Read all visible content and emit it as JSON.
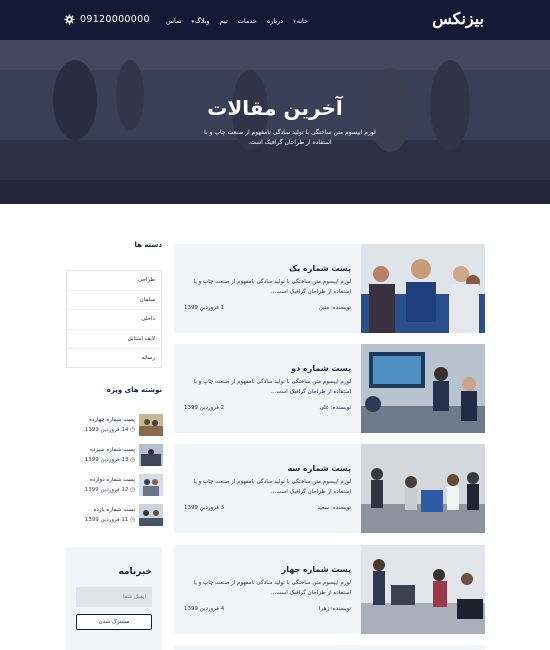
{
  "header": {
    "logo": "بیزنکس",
    "nav": [
      "خانه",
      "درباره",
      "خدمات",
      "تیم",
      "وبلاگ",
      "تماس"
    ],
    "phone": "09120000000"
  },
  "hero": {
    "title": "آخرین مقالات",
    "text": "لورم ایپسوم متن ساختگی با تولید سادگی نامفهوم از صنعت چاپ و با استفاده از طراحان گرافیک است."
  },
  "sidebar": {
    "categories_title": "دسته ها",
    "categories": [
      "طراحی",
      "مبلمان",
      "داخلی",
      "لایف استایل",
      "رسانه"
    ],
    "special_title": "نوشته های ویژه",
    "special": [
      {
        "title": "پست شماره چهارده",
        "date": "14 فروردین 1399"
      },
      {
        "title": "پست شماره سیزده",
        "date": "13 فروردین 1399"
      },
      {
        "title": "پست شماره دوازده",
        "date": "12 فروردین 1399"
      },
      {
        "title": "پست شماره یازده",
        "date": "11 فروردین 1399"
      }
    ],
    "newsletter": {
      "title": "خبرنامه",
      "placeholder": "ایمیل شما",
      "button": "مشترک شدن"
    }
  },
  "posts": [
    {
      "title": "پست شماره یک",
      "excerpt": "لورم ایپسوم متن ساختگی با تولید سادگی نامفهوم از صنعت چاپ و با استفاده از طراحان گرافیک است...",
      "author": "نویسنده: متین",
      "date": "1 فروردین 1399"
    },
    {
      "title": "پست شماره دو",
      "excerpt": "لورم ایپسوم متن ساختگی با تولید سادگی نامفهوم از صنعت چاپ و با استفاده از طراحان گرافیک است...",
      "author": "نویسنده: علی",
      "date": "2 فروردین 1399"
    },
    {
      "title": "پست شماره سه",
      "excerpt": "لورم ایپسوم متن ساختگی با تولید سادگی نامفهوم از صنعت چاپ و با استفاده از طراحان گرافیک است...",
      "author": "نویسنده: سعید",
      "date": "3 فروردین 1399"
    },
    {
      "title": "پست شماره چهار",
      "excerpt": "لورم ایپسوم متن ساختگی با تولید سادگی نامفهوم از صنعت چاپ و با استفاده از طراحان گرافیک است...",
      "author": "نویسنده: زهرا",
      "date": "4 فروردین 1399"
    }
  ],
  "colors": {
    "navy": "#141a33",
    "panel": "#f3f4f8",
    "text": "#1b1f3b"
  }
}
